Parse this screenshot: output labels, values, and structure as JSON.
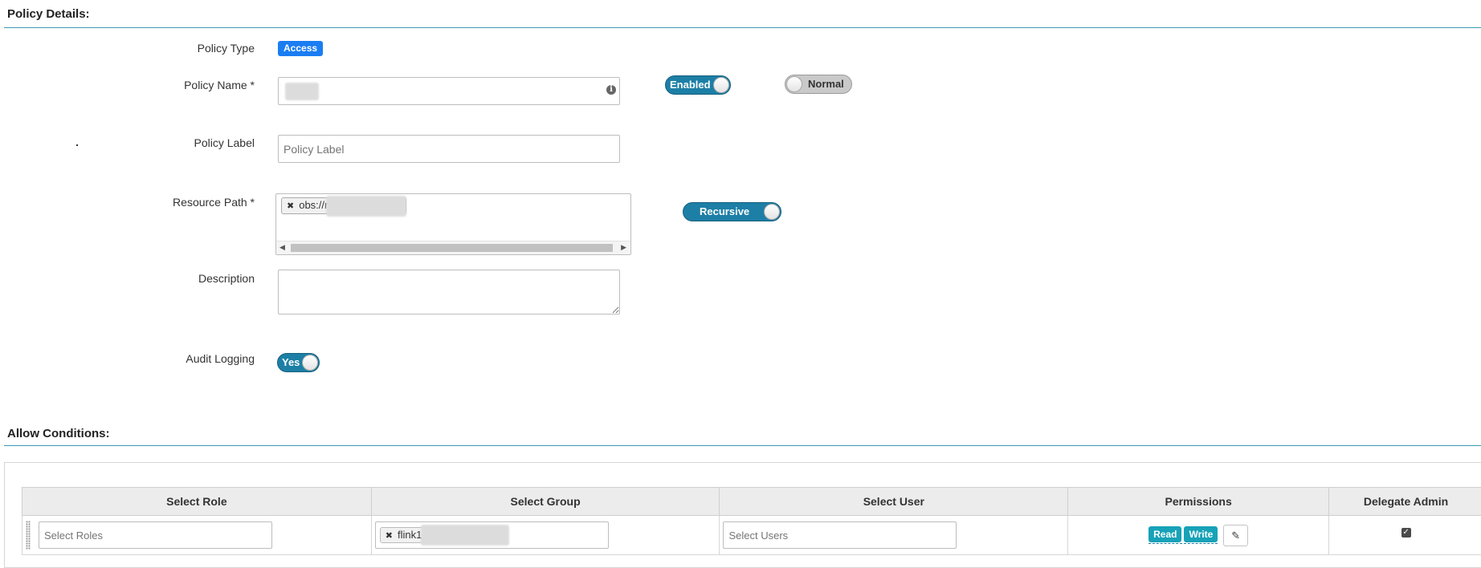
{
  "policy_details": {
    "section_title": "Policy Details:",
    "policy_type": {
      "label": "Policy Type",
      "value": "Access"
    },
    "policy_name": {
      "label": "Policy Name *",
      "value": ""
    },
    "policy_label": {
      "label": "Policy Label",
      "placeholder": "Policy Label"
    },
    "resource_path": {
      "label": "Resource Path *",
      "tag": "obs://r"
    },
    "description": {
      "label": "Description",
      "value": ""
    },
    "audit_logging": {
      "label": "Audit Logging",
      "toggle": "Yes"
    },
    "enabled_toggle": "Enabled",
    "normal_toggle": "Normal",
    "recursive_toggle": "Recursive"
  },
  "allow_conditions": {
    "section_title": "Allow Conditions:",
    "columns": [
      "Select Role",
      "Select Group",
      "Select User",
      "Permissions",
      "Delegate Admin"
    ],
    "row": {
      "roles_placeholder": "Select Roles",
      "group_tag": "flink1_",
      "users_placeholder": "Select Users",
      "permissions": [
        "Read",
        "Write"
      ],
      "delegate_admin": true
    }
  },
  "colors": {
    "accent_rule": "#3a9bb4",
    "toggle_on": "#1d7fa6",
    "access_badge": "#1a7df2",
    "perm_badge": "#17a2b8"
  },
  "icons": [
    "info-icon",
    "remove-tag-icon",
    "scroll-left-icon",
    "scroll-right-icon",
    "pencil-icon",
    "drag-handle-icon",
    "check-icon"
  ]
}
